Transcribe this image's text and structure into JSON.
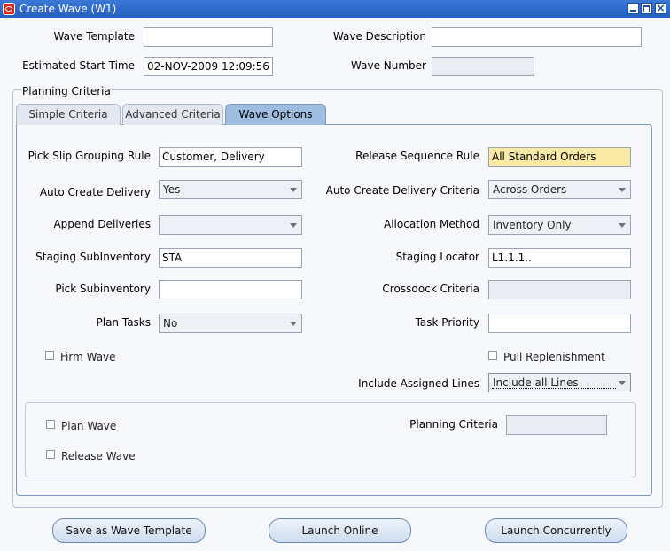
{
  "window": {
    "title": "Create Wave (W1)"
  },
  "header": {
    "wave_template_label": "Wave Template",
    "wave_template_value": "",
    "wave_description_label": "Wave Description",
    "wave_description_value": "",
    "estimated_start_label": "Estimated Start Time",
    "estimated_start_value": "02-NOV-2009 12:09:56",
    "wave_number_label": "Wave Number",
    "wave_number_value": ""
  },
  "planning_criteria": {
    "title": "Planning Criteria",
    "tabs": [
      {
        "label": "Simple Criteria",
        "active": false
      },
      {
        "label": "Advanced Criteria",
        "active": false
      },
      {
        "label": "Wave Options",
        "active": true
      }
    ]
  },
  "wave_options": {
    "pick_slip_grouping_label": "Pick Slip Grouping Rule",
    "pick_slip_grouping_value": "Customer, Delivery",
    "release_sequence_label": "Release Sequence Rule",
    "release_sequence_value": "All Standard Orders",
    "auto_create_delivery_label": "Auto Create Delivery",
    "auto_create_delivery_value": "Yes",
    "auto_create_delivery_criteria_label": "Auto Create Delivery Criteria",
    "auto_create_delivery_criteria_value": "Across Orders",
    "append_deliveries_label": "Append Deliveries",
    "append_deliveries_value": "",
    "allocation_method_label": "Allocation Method",
    "allocation_method_value": "Inventory Only",
    "staging_subinventory_label": "Staging SubInventory",
    "staging_subinventory_value": "STA",
    "staging_locator_label": "Staging Locator",
    "staging_locator_value": "L1.1.1..",
    "pick_subinventory_label": "Pick Subinventory",
    "pick_subinventory_value": "",
    "crossdock_criteria_label": "Crossdock Criteria",
    "crossdock_criteria_value": "",
    "plan_tasks_label": "Plan Tasks",
    "plan_tasks_value": "No",
    "task_priority_label": "Task Priority",
    "task_priority_value": "",
    "firm_wave_label": "Firm Wave",
    "pull_replenishment_label": "Pull Replenishment",
    "include_assigned_lines_label": "Include Assigned Lines",
    "include_assigned_lines_value": "Include all Lines"
  },
  "plan_section": {
    "plan_wave_label": "Plan Wave",
    "release_wave_label": "Release Wave",
    "planning_criteria_label": "Planning Criteria",
    "planning_criteria_value": ""
  },
  "actions": {
    "save_template_label": "Save as Wave Template",
    "launch_online_label": "Launch Online",
    "launch_concurrently_label": "Launch Concurrently"
  }
}
